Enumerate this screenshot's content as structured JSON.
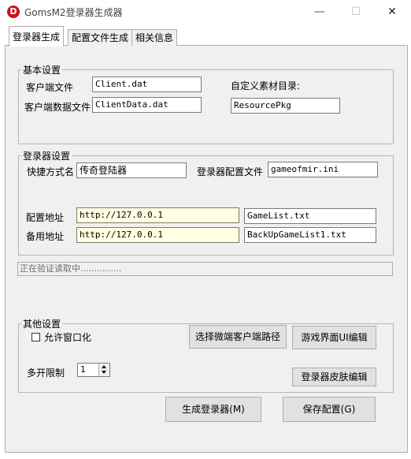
{
  "window": {
    "title": "GomsM2登录器生成器",
    "icon_letter": "D",
    "minimize_glyph": "—",
    "maximize_glyph": "☐",
    "close_glyph": "✕"
  },
  "tabs": [
    {
      "label": "登录器生成",
      "active": true
    },
    {
      "label": "配置文件生成",
      "active": false
    },
    {
      "label": "相关信息",
      "active": false
    }
  ],
  "basic": {
    "legend": "基本设置",
    "client_file_label": "客户端文件",
    "client_file_value": "Client.dat",
    "client_data_label": "客户端数据文件",
    "client_data_value": "ClientData.dat",
    "custom_dir_label": "自定义素材目录:",
    "custom_dir_value": "ResourcePkg"
  },
  "launcher": {
    "legend": "登录器设置",
    "shortcut_label": "快捷方式名",
    "shortcut_value": "传奇登陆器",
    "config_file_label": "登录器配置文件",
    "config_file_value": "gameofmir.ini",
    "config_addr_label": "配置地址",
    "config_addr_value": "http://127.0.0.1",
    "config_list_value": "GameList.txt",
    "backup_addr_label": "备用地址",
    "backup_addr_value": "http://127.0.0.1",
    "backup_list_value": "BackUpGameList1.txt"
  },
  "status_text": "正在验证读取中...............",
  "other": {
    "legend": "其他设置",
    "allow_window_label": "允许窗口化",
    "allow_window_checked": false,
    "select_client_button": "选择微端客户端路径",
    "ui_editor_button": "游戏界面UI编辑",
    "multi_open_label": "多开限制",
    "multi_open_value": "1",
    "skin_editor_button": "登录器皮肤编辑"
  },
  "actions": {
    "generate_button": "生成登录器(M)",
    "save_button": "保存配置(G)"
  }
}
